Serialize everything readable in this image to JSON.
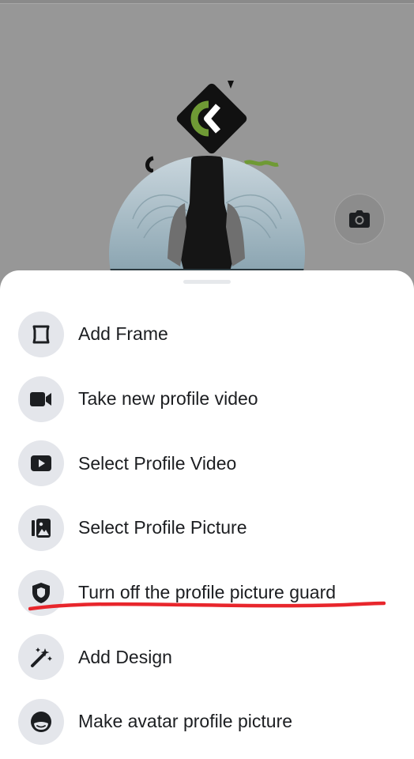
{
  "profile": {
    "camera_icon": "camera-icon"
  },
  "sheet": {
    "items": [
      {
        "label": "Add Frame",
        "icon": "frame-icon"
      },
      {
        "label": "Take new profile video",
        "icon": "video-camera-icon"
      },
      {
        "label": "Select Profile Video",
        "icon": "play-icon"
      },
      {
        "label": "Select Profile Picture",
        "icon": "photo-album-icon"
      },
      {
        "label": "Turn off the profile picture guard",
        "icon": "shield-icon"
      },
      {
        "label": "Add Design",
        "icon": "magic-wand-icon"
      },
      {
        "label": "Make avatar profile picture",
        "icon": "avatar-face-icon"
      }
    ]
  },
  "colors": {
    "overlay": "#979797",
    "sheet_bg": "#ffffff",
    "icon_bg": "#e4e6eb",
    "text": "#1c1e21",
    "annotation": "#e8262c",
    "logo_green": "#7aa83a"
  }
}
